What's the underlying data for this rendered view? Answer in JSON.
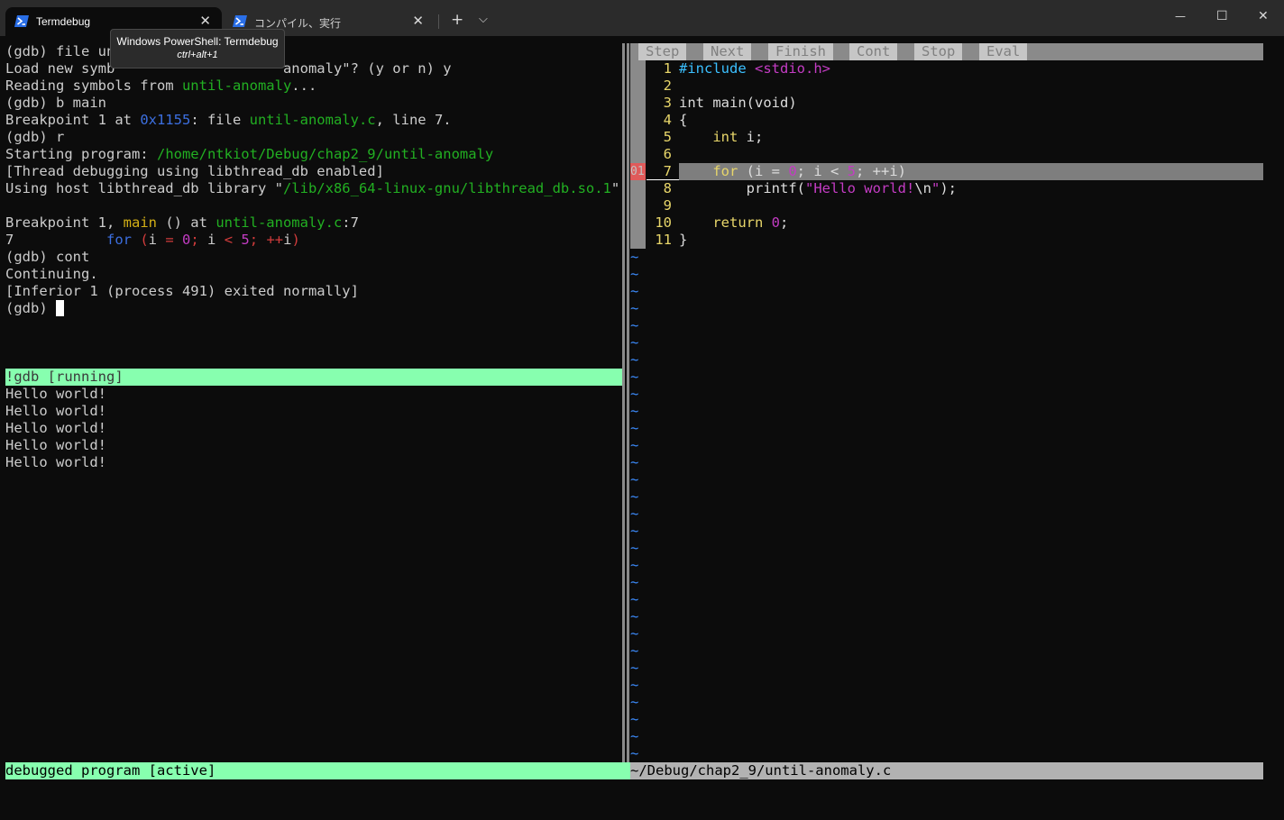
{
  "window": {
    "tabs": [
      {
        "label": "Termdebug",
        "active": true
      },
      {
        "label": "コンパイル、実行",
        "active": false
      }
    ],
    "tooltip": {
      "title": "Windows PowerShell: Termdebug",
      "shortcut": "ctrl+alt+1"
    },
    "icons": {
      "new_tab": "+",
      "dropdown": "⌵",
      "minimize": "—",
      "maximize": "☐",
      "close": "✕",
      "tab_close": "✕"
    }
  },
  "gdb_lines": [
    [
      {
        "t": "(gdb) file un"
      }
    ],
    [
      {
        "t": "Load new symb"
      },
      {
        "t": "                    "
      },
      {
        "t": "anomaly\"? (y or n) y"
      }
    ],
    [
      {
        "t": "Reading symbols from "
      },
      {
        "t": "until-anomaly",
        "c": "green"
      },
      {
        "t": "..."
      }
    ],
    [
      {
        "t": "(gdb) b main"
      }
    ],
    [
      {
        "t": "Breakpoint 1 at "
      },
      {
        "t": "0x1155",
        "c": "blue"
      },
      {
        "t": ": file "
      },
      {
        "t": "until-anomaly.c",
        "c": "green"
      },
      {
        "t": ", line 7."
      }
    ],
    [
      {
        "t": "(gdb) r"
      }
    ],
    [
      {
        "t": "Starting program: "
      },
      {
        "t": "/home/ntkiot/Debug/chap2_9/until-anomaly",
        "c": "green"
      }
    ],
    [
      {
        "t": "[Thread debugging using libthread_db enabled]"
      }
    ],
    [
      {
        "t": "Using host libthread_db library \""
      },
      {
        "t": "/lib/x86_64-linux-gnu/libthread_db.so.1",
        "c": "green"
      },
      {
        "t": "\"."
      }
    ],
    [
      {
        "t": ""
      }
    ],
    [
      {
        "t": "Breakpoint 1, "
      },
      {
        "t": "main",
        "c": "yellow"
      },
      {
        "t": " () at "
      },
      {
        "t": "until-anomaly.c",
        "c": "green"
      },
      {
        "t": ":7"
      }
    ],
    [
      {
        "t": "7           "
      },
      {
        "t": "for",
        "c": "blue"
      },
      {
        "t": " "
      },
      {
        "t": "(",
        "c": "red"
      },
      {
        "t": "i "
      },
      {
        "t": "=",
        "c": "red"
      },
      {
        "t": " "
      },
      {
        "t": "0",
        "c": "magenta"
      },
      {
        "t": ";",
        "c": "red"
      },
      {
        "t": " i "
      },
      {
        "t": "<",
        "c": "red"
      },
      {
        "t": " "
      },
      {
        "t": "5",
        "c": "magenta"
      },
      {
        "t": ";",
        "c": "red"
      },
      {
        "t": " "
      },
      {
        "t": "++",
        "c": "red"
      },
      {
        "t": "i"
      },
      {
        "t": ")",
        "c": "red"
      }
    ],
    [
      {
        "t": "(gdb) cont"
      }
    ],
    [
      {
        "t": "Continuing."
      }
    ],
    [
      {
        "t": "[Inferior 1 (process 491) exited normally]"
      }
    ],
    [
      {
        "t": "(gdb) "
      }
    ]
  ],
  "gdb_status": "!gdb [running]",
  "program_output": [
    "Hello world!",
    "Hello world!",
    "Hello world!",
    "Hello world!",
    "Hello world!"
  ],
  "program_status": "debugged program [active]",
  "winbar": [
    "Step",
    "Next",
    "Finish",
    "Cont",
    "Stop",
    "Eval"
  ],
  "breakpoint_sign": "01",
  "source": [
    {
      "n": "1",
      "parts": [
        {
          "t": "#include ",
          "c": "cyan"
        },
        {
          "t": "<stdio.h>",
          "c": "magenta"
        }
      ]
    },
    {
      "n": "2",
      "parts": []
    },
    {
      "n": "3",
      "parts": [
        {
          "t": "int main(void)"
        }
      ]
    },
    {
      "n": "4",
      "parts": [
        {
          "t": "{"
        }
      ]
    },
    {
      "n": "5",
      "parts": [
        {
          "t": "    "
        },
        {
          "t": "int",
          "c": "kw"
        },
        {
          "t": " i;"
        }
      ]
    },
    {
      "n": "6",
      "parts": []
    },
    {
      "n": "7",
      "parts": [
        {
          "t": "    "
        },
        {
          "t": "for",
          "c": "kw"
        },
        {
          "t": " (i = "
        },
        {
          "t": "0",
          "c": "magenta"
        },
        {
          "t": "; i < "
        },
        {
          "t": "5",
          "c": "magenta"
        },
        {
          "t": "; ++i)"
        }
      ]
    },
    {
      "n": "8",
      "parts": [
        {
          "t": "        printf("
        },
        {
          "t": "\"Hello world!",
          "c": "magenta"
        },
        {
          "t": "\\n"
        },
        {
          "t": "\"",
          "c": "magenta"
        },
        {
          "t": ");"
        }
      ]
    },
    {
      "n": "9",
      "parts": []
    },
    {
      "n": "10",
      "parts": [
        {
          "t": "    "
        },
        {
          "t": "return",
          "c": "kw"
        },
        {
          "t": " "
        },
        {
          "t": "0",
          "c": "magenta"
        },
        {
          "t": ";"
        }
      ]
    },
    {
      "n": "11",
      "parts": [
        {
          "t": "}"
        }
      ]
    }
  ],
  "tilde": "~",
  "empty_line_marker_count": 30,
  "file_status": "~/Debug/chap2_9/until-anomaly.c"
}
